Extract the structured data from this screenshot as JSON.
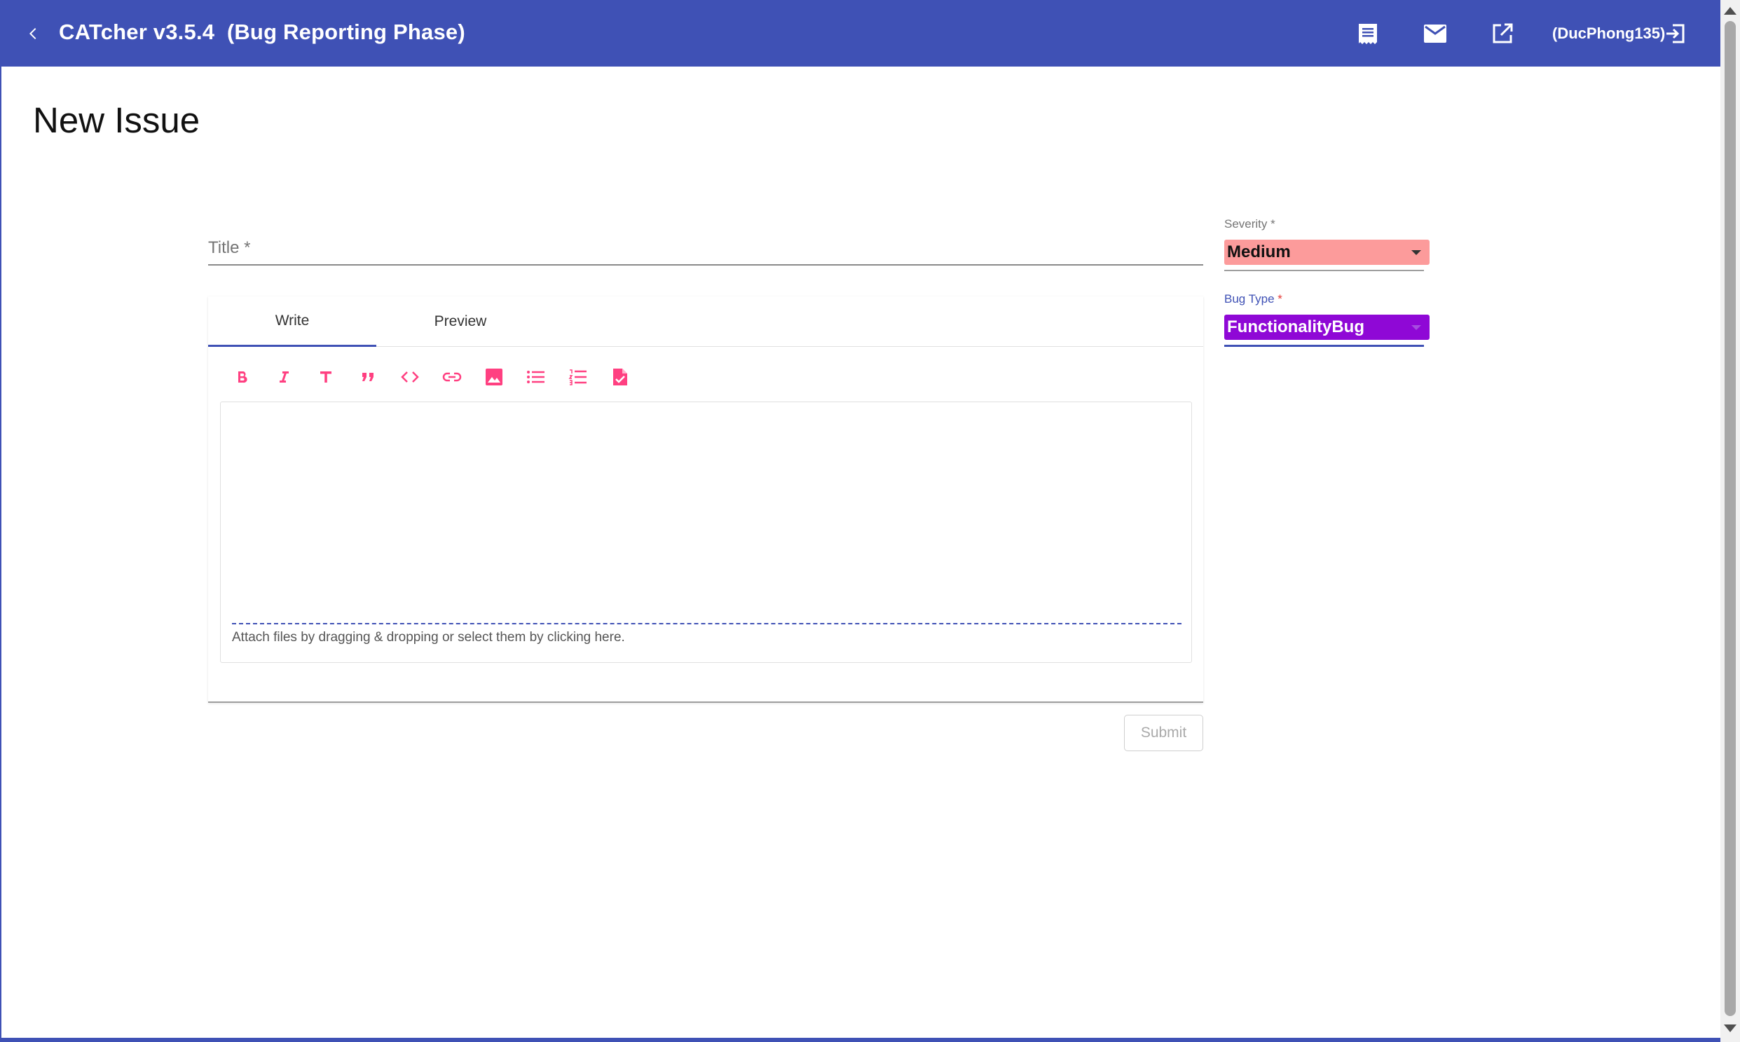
{
  "toolbar": {
    "title": "CATcher v3.5.4  (Bug Reporting Phase)",
    "user": "(DucPhong135)",
    "icons": [
      "back-arrow-icon",
      "notes-icon",
      "mail-icon",
      "open-in-new-icon",
      "logout-icon"
    ],
    "color": "#3f51b5"
  },
  "page": {
    "title": "New Issue"
  },
  "form": {
    "title_label": "Title",
    "title_required": "*",
    "title_value": "",
    "tabs": [
      {
        "label": "Write",
        "active": true
      },
      {
        "label": "Preview",
        "active": false
      }
    ],
    "format_icons": [
      "bold-icon",
      "italic-icon",
      "heading-icon",
      "quote-icon",
      "code-icon",
      "link-icon",
      "image-icon",
      "bulleted-list-icon",
      "numbered-list-icon",
      "task-file-icon"
    ],
    "accent_color": "#ff4081",
    "description_value": "",
    "attach_hint": "Attach files by dragging & dropping or select them by clicking here.",
    "submit_label": "Submit"
  },
  "severity": {
    "label": "Severity",
    "required": "*",
    "value": "Medium",
    "color": "#fc9b9b"
  },
  "bug_type": {
    "label": "Bug Type",
    "required": "*",
    "value": "FunctionalityBug",
    "color": "#8f08d6"
  }
}
